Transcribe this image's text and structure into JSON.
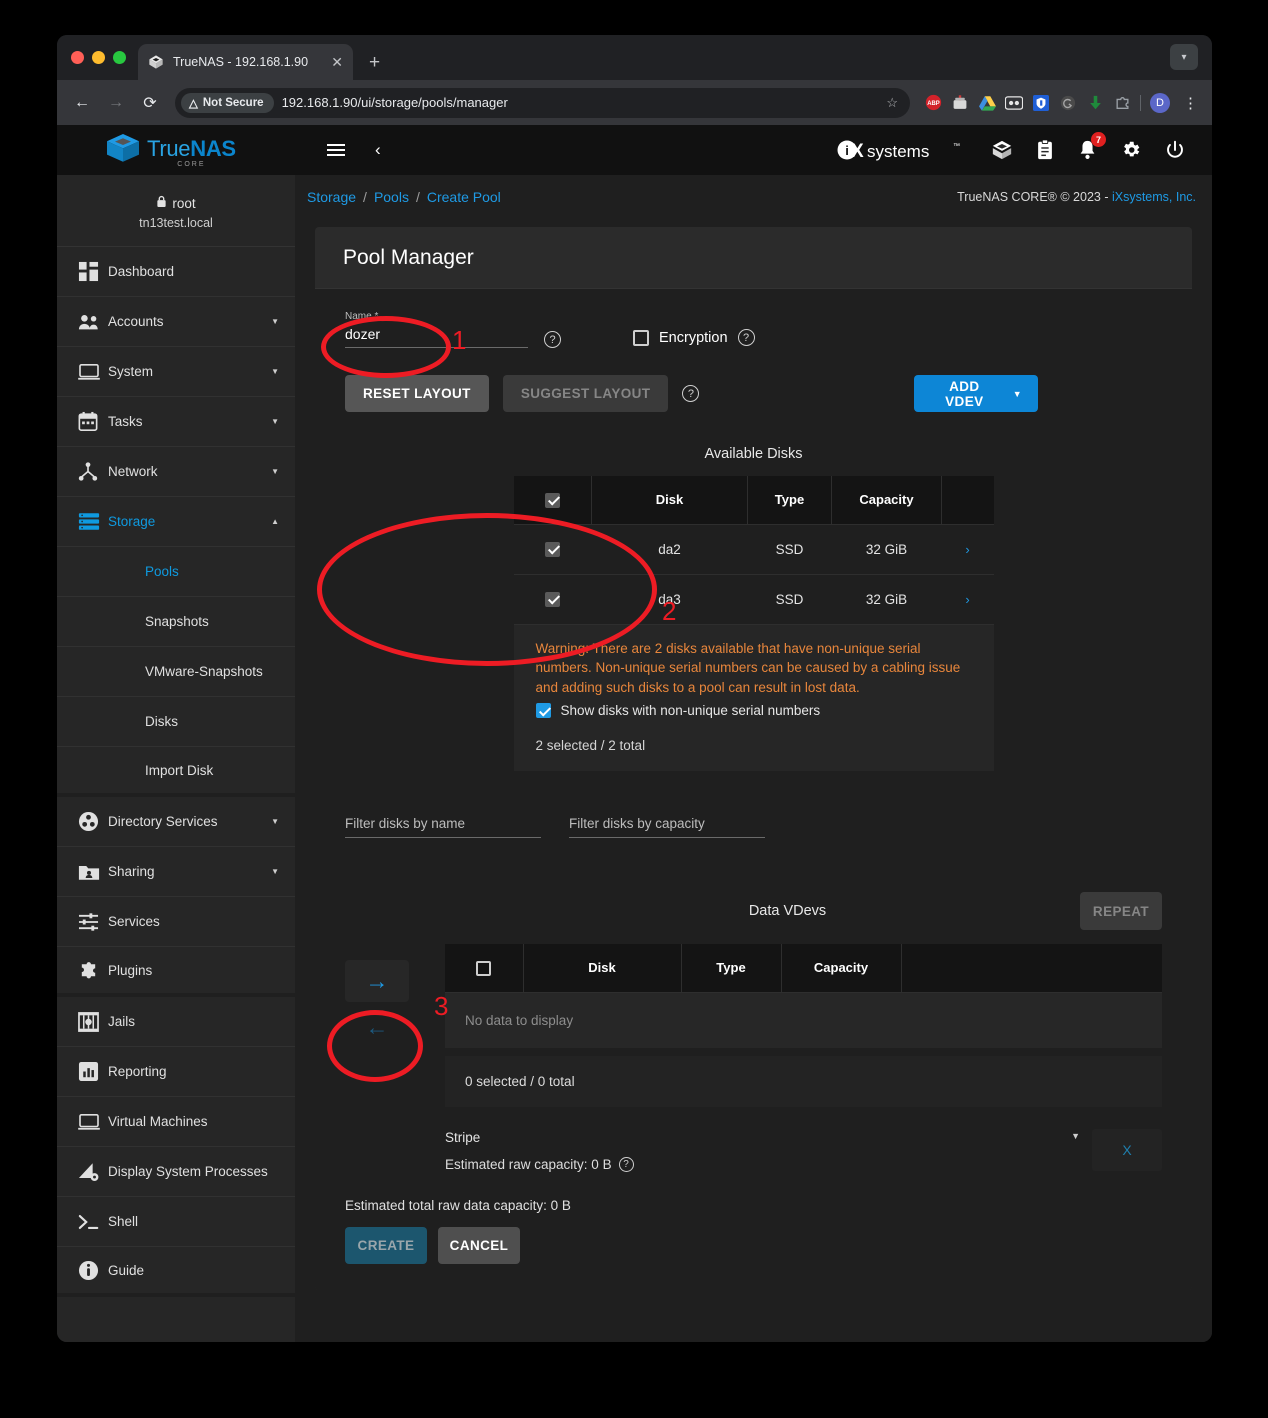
{
  "browser": {
    "tab": {
      "title": "TrueNAS - 192.168.1.90",
      "close": "✕",
      "favicon": "truenas-logo-icon"
    },
    "newtab_label": "+",
    "tab_rightcap": "▾",
    "nav": {
      "back": "←",
      "forward": "→",
      "reload": "⟳"
    },
    "security_label": "Not Secure",
    "security_icon": "warning-triangle-icon",
    "url": "192.168.1.90/ui/storage/pools/manager",
    "bookmark_icon": "☆",
    "extensions": [
      "adblock-plus-icon",
      "tampermonkey-icon",
      "google-drive-icon",
      "lastpass-icon",
      "bitwarden-icon",
      "grammarly-icon",
      "download-icon",
      "puzzle-extensions-icon"
    ],
    "profile_initial": "D",
    "menu_icon": "⋮"
  },
  "topbar": {
    "brand_true": "True",
    "brand_nas": "NAS",
    "brand_sub": "CORE",
    "menu_icon": "hamburger-icon",
    "collapse_icon": "‹",
    "ix_i": "i",
    "ix_x": "X",
    "ix_systems": "systems",
    "ix_tm": "™",
    "icons": [
      "jobs-icon",
      "tasks-clipboard-icon",
      "alerts-bell-icon",
      "settings-gear-icon",
      "power-icon"
    ],
    "alert_count": "7"
  },
  "sidebar": {
    "user": "root",
    "hostname": "tn13test.local",
    "lock_icon": "🔒",
    "items": [
      {
        "label": "Dashboard",
        "icon": "dashboard-icon",
        "caret": "",
        "active": false,
        "sub": false
      },
      {
        "label": "Accounts",
        "icon": "accounts-people-icon",
        "caret": "▼",
        "active": false,
        "sub": false
      },
      {
        "label": "System",
        "icon": "system-monitor-icon",
        "caret": "▼",
        "active": false,
        "sub": false
      },
      {
        "label": "Tasks",
        "icon": "tasks-calendar-icon",
        "caret": "▼",
        "active": false,
        "sub": false
      },
      {
        "label": "Network",
        "icon": "network-icon",
        "caret": "▼",
        "active": false,
        "sub": false
      },
      {
        "label": "Storage",
        "icon": "storage-icon",
        "caret": "▲",
        "active": true,
        "sub": false
      },
      {
        "label": "Pools",
        "icon": "",
        "caret": "",
        "active": true,
        "sub": true
      },
      {
        "label": "Snapshots",
        "icon": "",
        "caret": "",
        "active": false,
        "sub": true
      },
      {
        "label": "VMware-Snapshots",
        "icon": "",
        "caret": "",
        "active": false,
        "sub": true
      },
      {
        "label": "Disks",
        "icon": "",
        "caret": "",
        "active": false,
        "sub": true
      },
      {
        "label": "Import Disk",
        "icon": "",
        "caret": "",
        "active": false,
        "sub": true
      },
      {
        "label": "Directory Services",
        "icon": "directory-services-icon",
        "caret": "▼",
        "active": false,
        "sub": false
      },
      {
        "label": "Sharing",
        "icon": "sharing-folder-icon",
        "caret": "▼",
        "active": false,
        "sub": false
      },
      {
        "label": "Services",
        "icon": "services-sliders-icon",
        "caret": "",
        "active": false,
        "sub": false
      },
      {
        "label": "Plugins",
        "icon": "plugins-puzzle-icon",
        "caret": "",
        "active": false,
        "sub": false
      },
      {
        "label": "Jails",
        "icon": "jails-icon",
        "caret": "",
        "active": false,
        "sub": false
      },
      {
        "label": "Reporting",
        "icon": "reporting-chart-icon",
        "caret": "",
        "active": false,
        "sub": false
      },
      {
        "label": "Virtual Machines",
        "icon": "virtual-machines-icon",
        "caret": "",
        "active": false,
        "sub": false
      },
      {
        "label": "Display System Processes",
        "icon": "display-processes-icon",
        "caret": "",
        "active": false,
        "sub": false
      },
      {
        "label": "Shell",
        "icon": "shell-prompt-icon",
        "caret": "",
        "active": false,
        "sub": false
      },
      {
        "label": "Guide",
        "icon": "guide-info-icon",
        "caret": "",
        "active": false,
        "sub": false
      }
    ]
  },
  "breadcrumb": {
    "items": [
      "Storage",
      "Pools",
      "Create Pool"
    ],
    "separator": "/"
  },
  "copyright": {
    "text": "TrueNAS CORE® © 2023 - ",
    "link": "iXsystems, Inc.",
    "suffix": ""
  },
  "pool_manager": {
    "title": "Pool Manager",
    "name_field": {
      "label": "Name *",
      "value": "dozer",
      "help_icon": "help-circle-icon"
    },
    "encryption": {
      "label": "Encryption",
      "checked": false,
      "help_icon": "help-circle-icon"
    },
    "buttons": {
      "reset_layout": "RESET LAYOUT",
      "suggest_layout": "SUGGEST LAYOUT",
      "suggest_help_icon": "help-circle-icon",
      "add_vdev": "ADD VDEV",
      "add_vdev_caret": "▼"
    },
    "available_disks": {
      "title": "Available Disks",
      "columns": [
        "",
        "Disk",
        "Type",
        "Capacity",
        ""
      ],
      "header_checkbox_checked": true,
      "rows": [
        {
          "checked": true,
          "disk": "da2",
          "type": "SSD",
          "capacity": "32 GiB",
          "chevron": "›"
        },
        {
          "checked": true,
          "disk": "da3",
          "type": "SSD",
          "capacity": "32 GiB",
          "chevron": "›"
        }
      ],
      "warning": "Warning: There are 2 disks available that have non-unique serial numbers. Non-unique serial numbers can be caused by a cabling issue and adding such disks to a pool can result in lost data.",
      "show_nonunique": {
        "label": "Show disks with non-unique serial numbers",
        "checked": true
      },
      "selection_count": "2 selected / 2 total"
    },
    "filters": {
      "name_placeholder": "Filter disks by name",
      "name_value": "",
      "capacity_placeholder": "Filter disks by capacity",
      "capacity_value": ""
    },
    "data_vdevs": {
      "title": "Data VDevs",
      "repeat_button": "REPEAT",
      "move_right_icon": "→",
      "move_left_icon": "←",
      "columns": [
        "",
        "Disk",
        "Type",
        "Capacity",
        ""
      ],
      "header_checkbox_checked": false,
      "no_data": "No data to display",
      "selection_count": "0 selected / 0 total",
      "layout_value": "Stripe",
      "layout_caret": "▼",
      "raw_capacity": "Estimated raw capacity: 0 B",
      "raw_capacity_help_icon": "help-circle-icon",
      "remove_button": "X"
    },
    "total_capacity": "Estimated total raw data capacity: 0 B",
    "create_button": "CREATE",
    "cancel_button": "CANCEL"
  },
  "annotations": [
    {
      "number": "1"
    },
    {
      "number": "2"
    },
    {
      "number": "3"
    }
  ],
  "colors": {
    "accent_blue": "#0d86d6",
    "link_blue": "#1f9ae4",
    "warning_orange": "#e8863c",
    "annotation_red": "#ed1c24",
    "page_bg": "#1f1f1f",
    "sidebar_bg": "#262626",
    "topbar_bg": "#111111"
  }
}
